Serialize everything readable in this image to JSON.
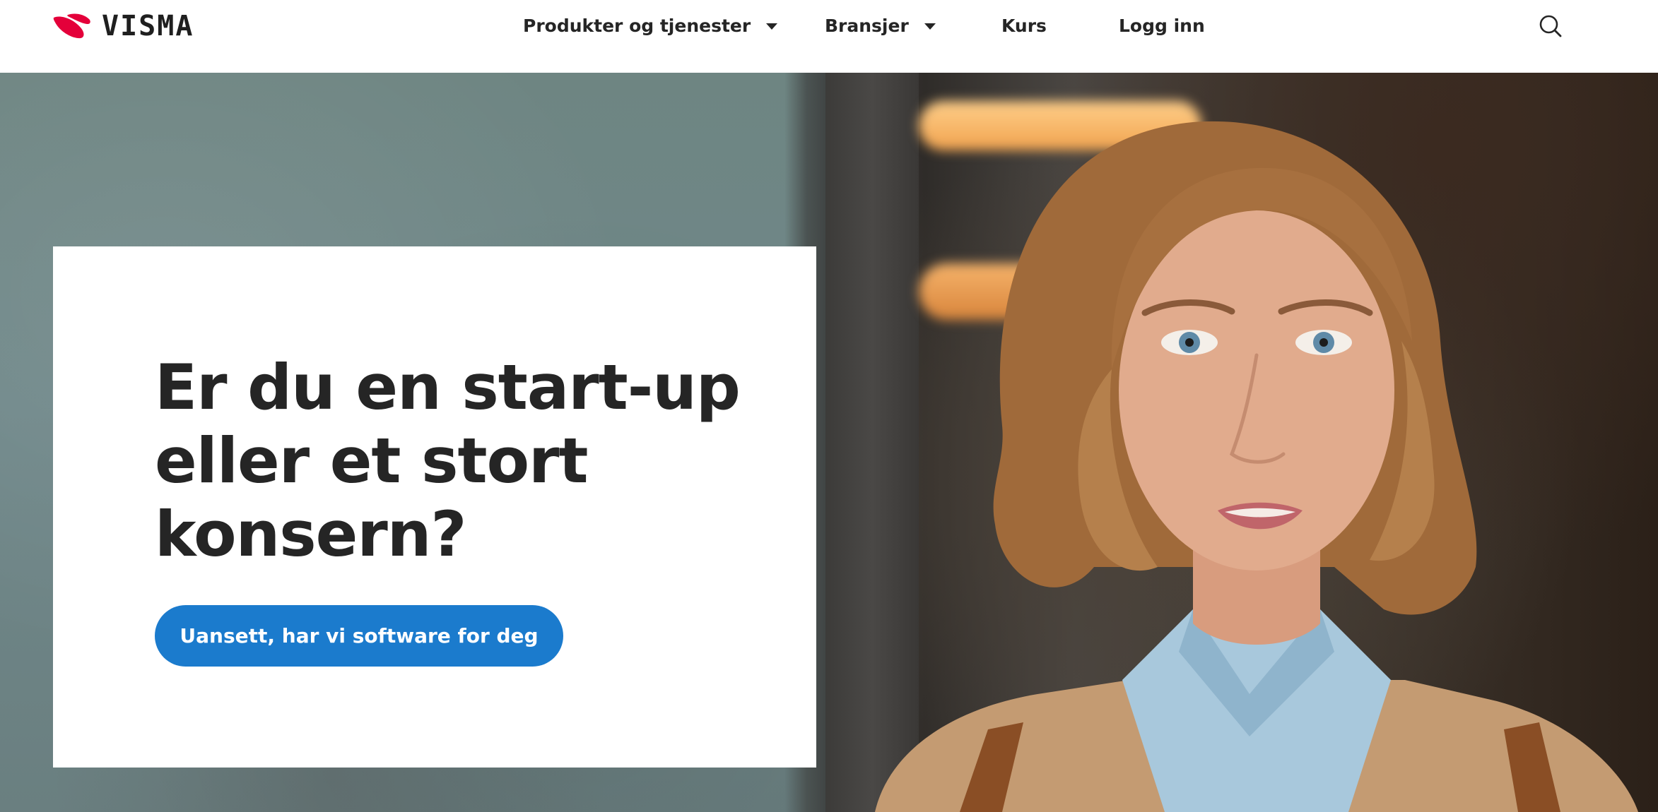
{
  "brand": {
    "name": "VISMA",
    "mark_color": "#e4003a"
  },
  "nav": {
    "items": [
      {
        "label": "Produkter og tjenester",
        "has_dropdown": true
      },
      {
        "label": "Bransjer",
        "has_dropdown": true
      },
      {
        "label": "Kurs",
        "has_dropdown": false
      },
      {
        "label": "Logg inn",
        "has_dropdown": false
      }
    ],
    "search_icon": "search-icon"
  },
  "hero": {
    "title": "Er du en start-up eller et stort konsern?",
    "cta_label": "Uansett, har vi software for deg",
    "cta_color": "#1b7bcd"
  },
  "colors": {
    "text": "#252525",
    "background": "#ffffff"
  }
}
